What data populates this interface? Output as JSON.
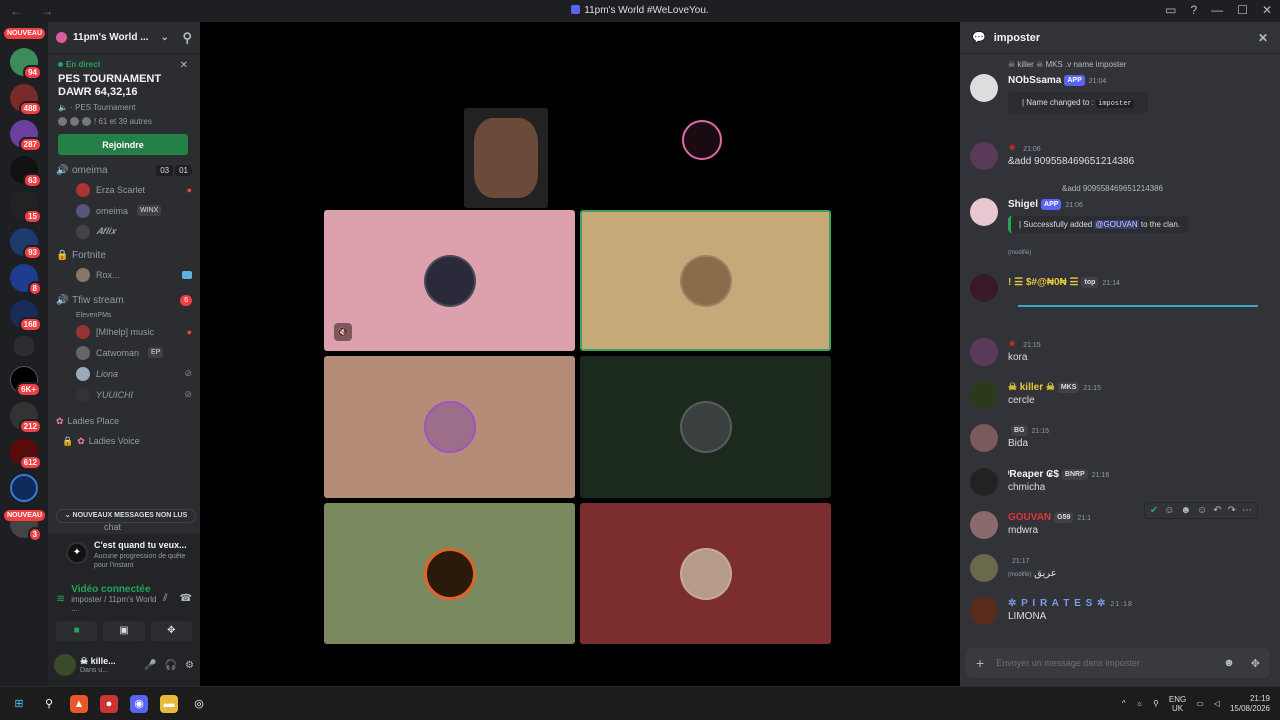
{
  "titlebar": {
    "title": "11pm's World #WeLoveYou.",
    "nav": "← →"
  },
  "servers": {
    "badges": [
      "94",
      "488",
      "287",
      "63",
      "15",
      "93",
      "8",
      "168",
      "6K+",
      "212",
      "612",
      "3"
    ],
    "nouveau_top": "NOUVEAU",
    "nouveau_bottom": "NOUVEAU"
  },
  "guild": {
    "name": "11pm's World ..."
  },
  "event": {
    "live_label": "En direct",
    "name": "PES TOURNAMENT DAWR 64,32,16",
    "channel": "PES Tournament",
    "attendees": "! 61 et 39 autres",
    "join_label": "Rejoindre"
  },
  "voice": {
    "omeima_channel": {
      "name": "omeima",
      "count_a": "03",
      "count_b": "01",
      "users": [
        "Erza Scarlet",
        "omeima",
        "𝑨𝒇𝒍𝒊𝒙"
      ],
      "user_tag": "WINX"
    },
    "fortnite": {
      "name": "Fortnite",
      "users": [
        "Rox..."
      ]
    },
    "tfiw": {
      "name": "Tfiw stream",
      "sub": "ElevenPMs",
      "badge": "6",
      "users": [
        "[MIhelp] music",
        "Catwoman",
        "Liona",
        "YUUICHI"
      ],
      "user_tag": "EP"
    },
    "ladies_cat": "Ladies Place",
    "ladies_voice": "Ladies Voice",
    "chat_label": "chat"
  },
  "new_messages_label": "NOUVEAUX MESSAGES NON LUS",
  "quest": {
    "title": "C'est quand tu veux...",
    "sub": "Aucune progression de quête pour l'instant"
  },
  "voice_connected": {
    "title": "Vidéo connectée",
    "sub": "imposter / 11pm's World ..."
  },
  "user": {
    "name": "☠ kille...",
    "status": "Dans u..."
  },
  "chat": {
    "channel": "imposter",
    "messages": {
      "m1_reply": "☠ killer ☠ MKS .v name imposter",
      "m1_user": "NObSsama",
      "m1_tag": "APP",
      "m1_time": "21:04",
      "m1_embed_prefix": "| Name changed to : ",
      "m1_embed_code": "imposter",
      "m2_time": "21:06",
      "m2_text": "&add 909558469651214386",
      "m3_reply": "&add 909558469651214386",
      "m3_user": "Shigel",
      "m3_tag": "APP",
      "m3_time": "21:06",
      "m3_embed_pre": "| Successfully added ",
      "m3_mention": "@GOUVAN",
      "m3_embed_post": " to the clan.",
      "m3_edited": "(modifié)",
      "m4_user": "! ☰ $#@₦0₦ ☰",
      "m4_tag": "top",
      "m4_time": "21:14",
      "m5_time": "21:15",
      "m5_text": "kora",
      "m6_user": "☠ killer ☠",
      "m6_tag": "MKS",
      "m6_time": "21:15",
      "m6_text": "cercle",
      "m7_tag": "BG",
      "m7_time": "21:15",
      "m7_text": "Bida",
      "m8_user": "ᶦReaper ₢$",
      "m8_tag": "BNRP",
      "m8_time": "21:16",
      "m8_text": "chmicha",
      "m9_user": "GOUVAN",
      "m9_tag": "G59",
      "m9_time": "21:1",
      "m9_text": "mdwra",
      "m10_time": "21:17",
      "m10_edited": "(modifié)",
      "m10_text": "عريق",
      "m11_user": "✲ P I R A T E S ✲",
      "m11_time": "21:18",
      "m11_text": "LIMONA"
    },
    "composer_placeholder": "Envoyer un message dans imposter"
  },
  "taskbar": {
    "lang": "ENG",
    "region": "UK",
    "time": "21:19",
    "date": "15/08/2026"
  },
  "colors": {
    "accent": "#5865f2",
    "online": "#23a55a",
    "danger": "#f23f43"
  }
}
